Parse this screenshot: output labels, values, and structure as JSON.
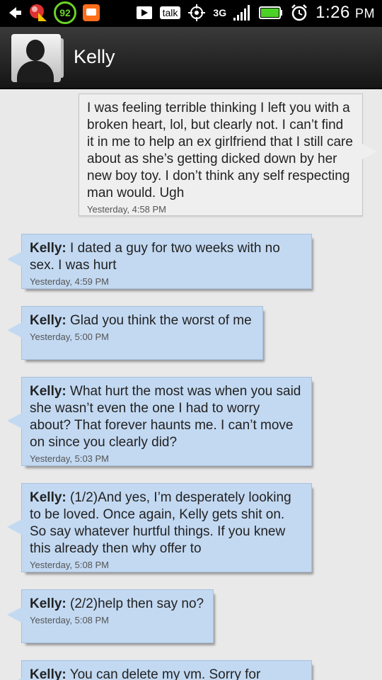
{
  "status_bar": {
    "icons": [
      "back-icon",
      "alert-icon",
      "battery-saver-92-icon",
      "orange-app-icon",
      "play-store-icon",
      "talk-icon",
      "gps-icon",
      "3g-icon",
      "signal-icon",
      "battery-icon",
      "alarm-icon"
    ],
    "badge_value": "92",
    "talk_label": "talk",
    "network": "3G",
    "time": "1:26",
    "ampm": "PM"
  },
  "header": {
    "contact_name": "Kelly"
  },
  "messages": [
    {
      "direction": "outgoing",
      "sender": "",
      "text": "I was feeling terrible thinking I left you with a broken heart, lol, but clearly not. I can’t find it in me to help an ex girlfriend that I still care about as she’s getting dicked down by her new boy toy. I don’t think any self respecting man would. Ugh",
      "time": "Yesterday, 4:58 PM"
    },
    {
      "direction": "incoming",
      "sender": "Kelly:",
      "text": "I dated a guy for two weeks with no sex. I was hurt",
      "time": "Yesterday, 4:59 PM"
    },
    {
      "direction": "incoming",
      "sender": "Kelly:",
      "text": "Glad you think the worst of me",
      "time": "Yesterday, 5:00 PM"
    },
    {
      "direction": "incoming",
      "sender": "Kelly:",
      "text": "What hurt the most was when you said she wasn’t even the one I had to worry about? That forever haunts me. I can’t move on since you clearly did?",
      "time": "Yesterday, 5:03 PM"
    },
    {
      "direction": "incoming",
      "sender": "Kelly:",
      "text": "(1/2)And yes, I’m desperately looking to be loved. Once again, Kelly gets shit on. So say whatever hurtful things. If you knew this already then why offer to",
      "time": "Yesterday, 5:08 PM"
    },
    {
      "direction": "incoming",
      "sender": "Kelly:",
      "text": "(2/2)help then say no?",
      "time": "Yesterday, 5:08 PM"
    },
    {
      "direction": "incoming",
      "sender": "Kelly:",
      "text": "You can delete my vm. Sorry for",
      "time": ""
    }
  ],
  "colors": {
    "incoming_bubble": "#c3d9f2",
    "outgoing_bubble": "#efefef",
    "background": "#e9e9e9",
    "header": "#222222"
  }
}
